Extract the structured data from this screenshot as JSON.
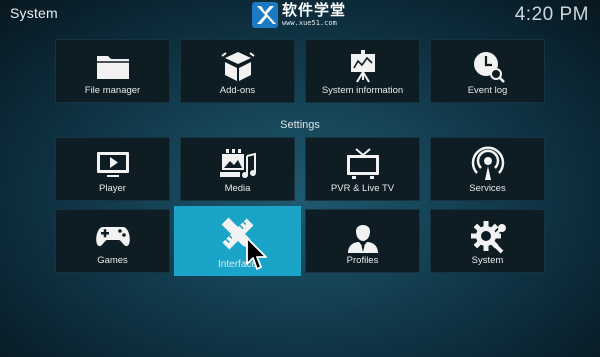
{
  "header": {
    "title": "System",
    "clock": "4:20 PM"
  },
  "watermark": {
    "text": "软件学堂",
    "url": "www.xue51.com"
  },
  "top_row": [
    {
      "label": "File manager",
      "icon": "folder-icon"
    },
    {
      "label": "Add-ons",
      "icon": "addons-box-icon"
    },
    {
      "label": "System information",
      "icon": "presentation-chart-icon"
    },
    {
      "label": "Event log",
      "icon": "clock-search-icon"
    }
  ],
  "settings": {
    "title": "Settings",
    "items": [
      {
        "label": "Player",
        "icon": "player-screen-icon"
      },
      {
        "label": "Media",
        "icon": "media-icon"
      },
      {
        "label": "PVR & Live TV",
        "icon": "tv-icon"
      },
      {
        "label": "Services",
        "icon": "broadcast-icon"
      },
      {
        "label": "Games",
        "icon": "gamepad-icon"
      },
      {
        "label": "Interface",
        "icon": "pencil-ruler-icon"
      },
      {
        "label": "Profiles",
        "icon": "user-profile-icon"
      },
      {
        "label": "System",
        "icon": "gear-wrench-icon"
      }
    ]
  },
  "focused_item": "Interface",
  "colors": {
    "accent": "#1aa4c7",
    "tile": "#0e1d24",
    "background": "#123b4d"
  }
}
